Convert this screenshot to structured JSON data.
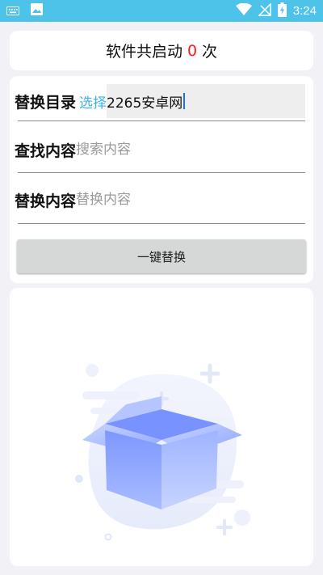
{
  "status_bar": {
    "time": "3:24",
    "background": "#4dc3e9",
    "left_icons": [
      "keyboard-icon",
      "image-icon"
    ],
    "right_icons": [
      "wifi-icon",
      "no-signal-icon",
      "battery-charging-icon"
    ]
  },
  "counter": {
    "prefix": "软件共启动",
    "count": "0",
    "suffix": "次",
    "count_color": "#ff1a1a"
  },
  "form": {
    "directory": {
      "label": "替换目录",
      "select_label": "选择",
      "value": "2265安卓网"
    },
    "find": {
      "label": "查找内容",
      "placeholder": "搜索内容",
      "value": ""
    },
    "replace": {
      "label": "替换内容",
      "placeholder": "替换内容",
      "value": ""
    },
    "action_label": "一键替换"
  },
  "empty_state": {
    "icon": "empty-box-icon",
    "accent": "#7f9cff"
  }
}
